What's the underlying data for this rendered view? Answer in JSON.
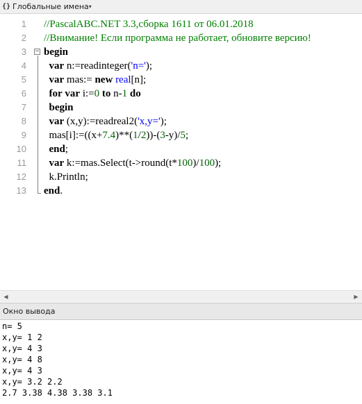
{
  "header": {
    "icon_glyph": "{}",
    "title": "Глобальные имена",
    "dropdown_glyph": "▾"
  },
  "editor": {
    "line_numbers": [
      "1",
      "2",
      "3",
      "4",
      "5",
      "6",
      "7",
      "8",
      "9",
      "10",
      "11",
      "12",
      "13"
    ],
    "lines": [
      [
        {
          "t": "//PascalABC.NET 3.3,сборка 1611 от 06.01.2018",
          "c": "cm"
        }
      ],
      [
        {
          "t": "//Внимание! Если программа не работает, обновите версию!",
          "c": "cm"
        }
      ],
      [
        {
          "t": "begin",
          "c": "kw"
        }
      ],
      [
        {
          "t": "  "
        },
        {
          "t": "var",
          "c": "kw"
        },
        {
          "t": " n:=readinteger("
        },
        {
          "t": "'n='",
          "c": "str"
        },
        {
          "t": ");"
        }
      ],
      [
        {
          "t": "  "
        },
        {
          "t": "var",
          "c": "kw"
        },
        {
          "t": " mas:= "
        },
        {
          "t": "new",
          "c": "kw"
        },
        {
          "t": " "
        },
        {
          "t": "real",
          "c": "ty"
        },
        {
          "t": "[n];"
        }
      ],
      [
        {
          "t": "  "
        },
        {
          "t": "for",
          "c": "kw"
        },
        {
          "t": " "
        },
        {
          "t": "var",
          "c": "kw"
        },
        {
          "t": " i:="
        },
        {
          "t": "0",
          "c": "num"
        },
        {
          "t": " "
        },
        {
          "t": "to",
          "c": "kw"
        },
        {
          "t": " n-"
        },
        {
          "t": "1",
          "c": "num"
        },
        {
          "t": " "
        },
        {
          "t": "do",
          "c": "kw"
        }
      ],
      [
        {
          "t": "  "
        },
        {
          "t": "begin",
          "c": "kw"
        }
      ],
      [
        {
          "t": "  "
        },
        {
          "t": "var",
          "c": "kw"
        },
        {
          "t": " (x,y):=readreal2("
        },
        {
          "t": "'x,y='",
          "c": "str"
        },
        {
          "t": ");"
        }
      ],
      [
        {
          "t": "  mas[i]:=((x+"
        },
        {
          "t": "7.4",
          "c": "num"
        },
        {
          "t": ")**("
        },
        {
          "t": "1",
          "c": "num"
        },
        {
          "t": "/"
        },
        {
          "t": "2",
          "c": "num"
        },
        {
          "t": "))-("
        },
        {
          "t": "3",
          "c": "num"
        },
        {
          "t": "-y)/"
        },
        {
          "t": "5",
          "c": "num"
        },
        {
          "t": ";"
        }
      ],
      [
        {
          "t": "  "
        },
        {
          "t": "end",
          "c": "kw"
        },
        {
          "t": ";"
        }
      ],
      [
        {
          "t": "  "
        },
        {
          "t": "var",
          "c": "kw"
        },
        {
          "t": " k:=mas.Select(t->round(t*"
        },
        {
          "t": "100",
          "c": "num"
        },
        {
          "t": ")/"
        },
        {
          "t": "100",
          "c": "num"
        },
        {
          "t": ");"
        }
      ],
      [
        {
          "t": "  k.Println;"
        }
      ],
      [
        {
          "t": "end",
          "c": "kw"
        },
        {
          "t": "."
        }
      ]
    ],
    "fold_glyph": "−"
  },
  "hscroll": {
    "left_arrow": "◀",
    "right_arrow": "▶"
  },
  "output": {
    "title": "Окно вывода",
    "lines": [
      "n= 5",
      "x,y= 1 2",
      "x,y= 4 3",
      "x,y= 4 8",
      "x,y= 4 3",
      "x,y= 3.2 2.2",
      "2.7 3.38 4.38 3.38 3.1"
    ]
  }
}
